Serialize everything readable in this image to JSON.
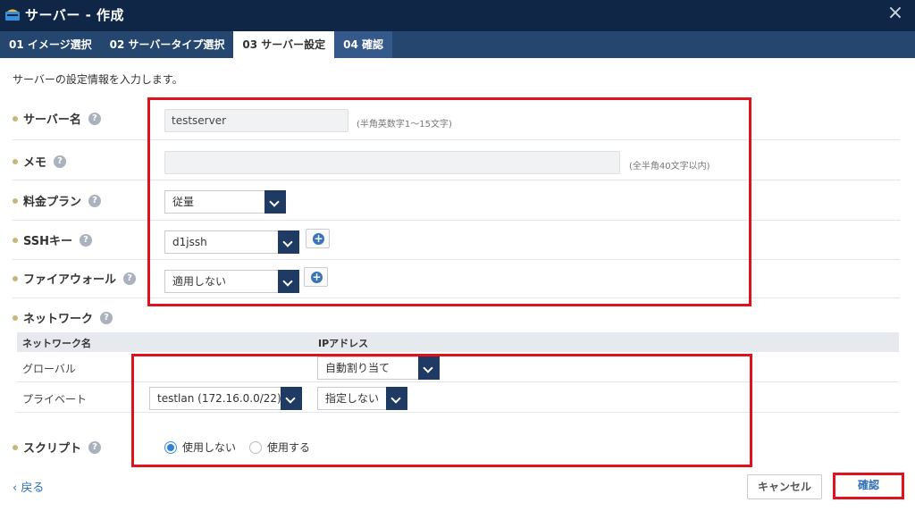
{
  "window": {
    "title": "サーバー - 作成",
    "close_label": "×"
  },
  "tabs": [
    {
      "label": "01 イメージ選択"
    },
    {
      "label": "02 サーバータイプ選択"
    },
    {
      "label": "03 サーバー設定"
    },
    {
      "label": "04 確認"
    }
  ],
  "intro": "サーバーの設定情報を入力します。",
  "help_glyph": "?",
  "fields": {
    "server_name": {
      "label": "サーバー名",
      "value": "testserver",
      "hint": "(半角英数字1～15文字)"
    },
    "memo": {
      "label": "メモ",
      "value": "",
      "hint": "(全半角40文字以内)"
    },
    "plan": {
      "label": "料金プラン",
      "value": "従量"
    },
    "ssh_key": {
      "label": "SSHキー",
      "value": "d1jssh"
    },
    "firewall": {
      "label": "ファイアウォール",
      "value": "適用しない"
    },
    "network": {
      "label": "ネットワーク",
      "headers": {
        "name": "ネットワーク名",
        "ip": "IPアドレス"
      },
      "global": {
        "name": "グローバル",
        "ip": "自動割り当て"
      },
      "private": {
        "name": "プライベート",
        "lan": "testlan (172.16.0.0/22)",
        "ip": "指定しない"
      }
    },
    "script": {
      "label": "スクリプト",
      "option_off": "使用しない",
      "option_on": "使用する",
      "selected": "使用しない"
    }
  },
  "footer": {
    "back": "戻る",
    "cancel": "キャンセル",
    "confirm": "確認"
  },
  "colors": {
    "titlebar": "#0f2646",
    "tabs": "#24466f",
    "accent": "#1f3b63",
    "highlight": "#e0121b",
    "link": "#2f6fb5"
  }
}
